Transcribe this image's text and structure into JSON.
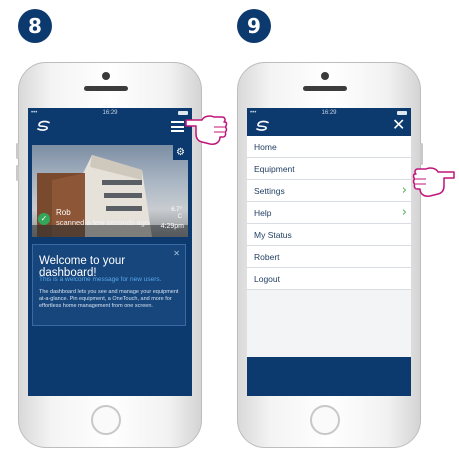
{
  "steps": {
    "left": "8",
    "right": "9"
  },
  "status": {
    "time": "16:29",
    "dots": "•••"
  },
  "dashboard": {
    "device_name": "Rob",
    "device_status": "scanned a few seconds ago",
    "temp_line1": "6.7°",
    "temp_line2": "C",
    "device_time": "4:29pm",
    "welcome_title": "Welcome to your dashboard!",
    "welcome_sub": "This is a welcome message for new users.",
    "welcome_body": "The dashboard lets you see and manage your equipment at-a-glance. Pin equipment, a OneTouch, and more for effortless home management from one screen."
  },
  "menu": {
    "items": [
      {
        "label": "Home",
        "chevron": false
      },
      {
        "label": "Equipment",
        "chevron": false
      },
      {
        "label": "Settings",
        "chevron": true
      },
      {
        "label": "Help",
        "chevron": true
      },
      {
        "label": "My Status",
        "chevron": false
      },
      {
        "label": "Robert",
        "chevron": false
      },
      {
        "label": "Logout",
        "chevron": false
      }
    ]
  },
  "icons": [
    "logo-icon",
    "menu-icon",
    "gear-icon",
    "check-icon",
    "close-icon",
    "chevron-right-icon",
    "pointing-hand-icon"
  ],
  "colors": {
    "primary": "#0d3a6e",
    "accent": "#4caf50",
    "link": "#56a8e6"
  }
}
